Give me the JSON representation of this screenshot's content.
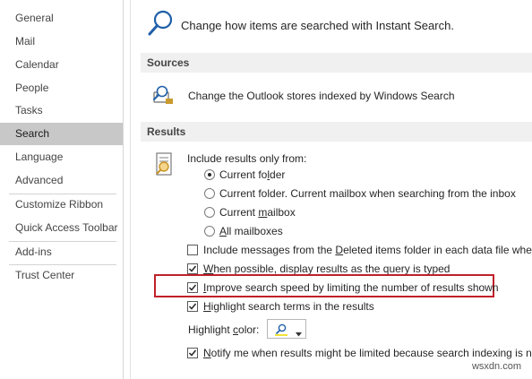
{
  "sidebar": {
    "items": [
      {
        "label": "General"
      },
      {
        "label": "Mail"
      },
      {
        "label": "Calendar"
      },
      {
        "label": "People"
      },
      {
        "label": "Tasks"
      },
      {
        "label": "Search",
        "selected": true
      },
      {
        "label": "Language"
      },
      {
        "label": "Advanced"
      },
      {
        "label": "Customize Ribbon"
      },
      {
        "label": "Quick Access Toolbar"
      },
      {
        "label": "Add-ins"
      },
      {
        "label": "Trust Center"
      }
    ]
  },
  "main": {
    "intro_text": "Change how items are searched with Instant Search.",
    "sources": {
      "header": "Sources",
      "description": "Change the Outlook stores indexed by Windows Search"
    },
    "results": {
      "header": "Results",
      "include_label": "Include results only from:",
      "radio_options": [
        {
          "label_pre": "Current fo",
          "label_ul": "l",
          "label_post": "der",
          "selected": true
        },
        {
          "label_pre": "Current folder. Current mailbox when searching from the inbox",
          "label_ul": "",
          "label_post": "",
          "selected": false
        },
        {
          "label_pre": "Current ",
          "label_ul": "m",
          "label_post": "ailbox",
          "selected": false
        },
        {
          "label_pre": "",
          "label_ul": "A",
          "label_post": "ll mailboxes",
          "selected": false
        }
      ],
      "checkboxes": [
        {
          "label_pre": "Include messages from the ",
          "label_ul": "D",
          "label_post": "eleted items folder in each data file when sea",
          "checked": false
        },
        {
          "label_pre": "",
          "label_ul": "W",
          "label_post": "hen possible, display results as the query is typed",
          "checked": true
        },
        {
          "label_pre": "",
          "label_ul": "I",
          "label_post": "mprove search speed by limiting the number of results shown",
          "checked": true
        },
        {
          "label_pre": "",
          "label_ul": "H",
          "label_post": "ighlight search terms in the results",
          "checked": true
        }
      ],
      "highlight_color_pre": "Highlight ",
      "highlight_color_ul": "c",
      "highlight_color_post": "olor:",
      "notify": {
        "label_pre": "",
        "label_ul": "N",
        "label_post": "otify me when results might be limited because search indexing is not c",
        "checked": true
      }
    }
  },
  "watermark": "wsxdn.com",
  "colors": {
    "selected_nav_bg": "#c8c8c8",
    "section_header_bg": "#f0f0f0",
    "annotation_red": "#c0202a",
    "accent_blue": "#1f5fa8"
  }
}
